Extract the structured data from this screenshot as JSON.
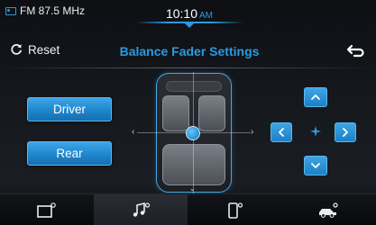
{
  "status": {
    "radio_text": "FM 87.5 MHz",
    "time": "10:10",
    "ampm": "AM"
  },
  "header": {
    "reset_label": "Reset",
    "title": "Balance Fader Settings",
    "back_icon": "back-arrow-icon"
  },
  "presets": {
    "driver_label": "Driver",
    "rear_label": "Rear"
  },
  "balance": {
    "left_arrow": "‹",
    "right_arrow": "›",
    "down_arrow": "⌄"
  },
  "bottom_nav": {
    "items": [
      {
        "icon": "screen-settings-icon"
      },
      {
        "icon": "music-settings-icon",
        "active": true
      },
      {
        "icon": "phone-settings-icon"
      },
      {
        "icon": "vehicle-settings-icon"
      }
    ]
  },
  "colors": {
    "accent": "#2b9ae0",
    "background": "#15181d",
    "button_top": "#3fa5e6",
    "button_bottom": "#166fae"
  }
}
